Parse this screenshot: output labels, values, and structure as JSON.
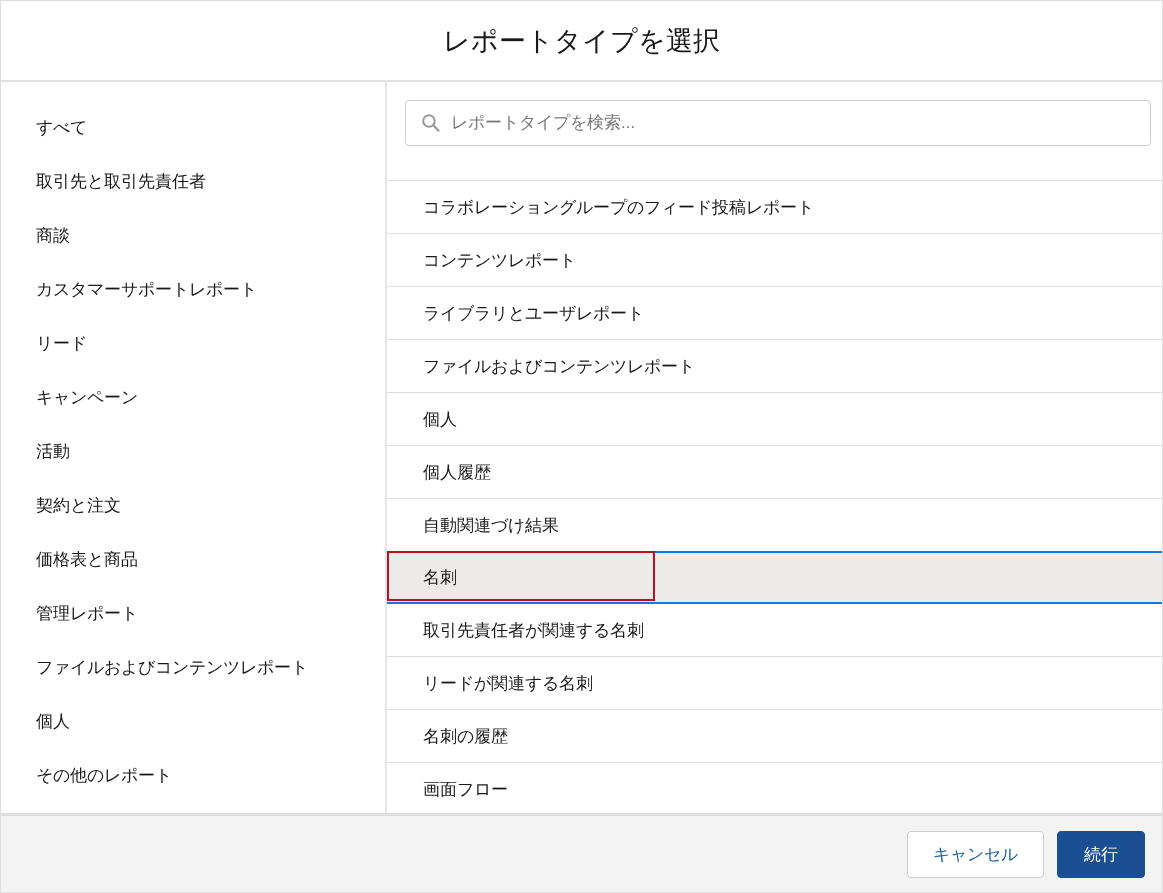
{
  "dialog": {
    "title": "レポートタイプを選択"
  },
  "categories": [
    {
      "label": "すべて"
    },
    {
      "label": "取引先と取引先責任者"
    },
    {
      "label": "商談"
    },
    {
      "label": "カスタマーサポートレポート"
    },
    {
      "label": "リード"
    },
    {
      "label": "キャンペーン"
    },
    {
      "label": "活動"
    },
    {
      "label": "契約と注文"
    },
    {
      "label": "価格表と商品"
    },
    {
      "label": "管理レポート"
    },
    {
      "label": "ファイルおよびコンテンツレポート"
    },
    {
      "label": "個人"
    },
    {
      "label": "その他のレポート"
    }
  ],
  "search": {
    "placeholder": "レポートタイプを検索..."
  },
  "report_types": [
    {
      "label": "コラボレーショングループのフィード投稿レポート",
      "selected": false,
      "annotated": false
    },
    {
      "label": "コンテンツレポート",
      "selected": false,
      "annotated": false
    },
    {
      "label": "ライブラリとユーザレポート",
      "selected": false,
      "annotated": false
    },
    {
      "label": "ファイルおよびコンテンツレポート",
      "selected": false,
      "annotated": false
    },
    {
      "label": "個人",
      "selected": false,
      "annotated": false
    },
    {
      "label": "個人履歴",
      "selected": false,
      "annotated": false
    },
    {
      "label": "自動関連づけ結果",
      "selected": false,
      "annotated": false
    },
    {
      "label": "名刺",
      "selected": true,
      "annotated": true
    },
    {
      "label": "取引先責任者が関連する名刺",
      "selected": false,
      "annotated": false
    },
    {
      "label": "リードが関連する名刺",
      "selected": false,
      "annotated": false
    },
    {
      "label": "名刺の履歴",
      "selected": false,
      "annotated": false
    },
    {
      "label": "画面フロー",
      "selected": false,
      "annotated": false
    }
  ],
  "buttons": [
    {
      "label": "キャンセル",
      "kind": "neutral"
    },
    {
      "label": "続行",
      "kind": "brand"
    }
  ]
}
